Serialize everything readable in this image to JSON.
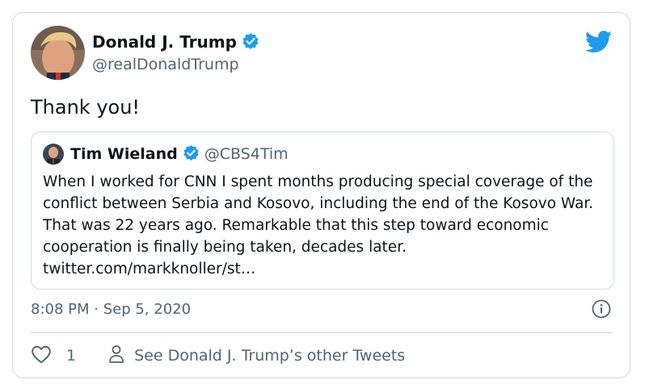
{
  "author": {
    "name": "Donald J. Trump",
    "handle": "@realDonaldTrump"
  },
  "tweet": {
    "text": "Thank you!",
    "timestamp": "8:08 PM · Sep 5, 2020"
  },
  "quoted": {
    "name": "Tim Wieland",
    "handle": "@CBS4Tim",
    "text": "When I worked for CNN I spent months producing special coverage of the conflict between Serbia and Kosovo, including the end of the Kosovo War. That was 22 years ago. Remarkable that this step toward economic cooperation is finally being taken, decades later. twitter.com/markknoller/st…"
  },
  "footer": {
    "like_count": "1",
    "profile_link": "See Donald J. Trump’s other Tweets"
  },
  "icons": {
    "twitter": "twitter-bird-icon",
    "verified": "verified-badge-icon",
    "info": "info-icon",
    "like": "heart-icon",
    "profile": "person-icon"
  },
  "colors": {
    "brand": "#1d9bf0",
    "text": "#0f1419",
    "secondary": "#536471",
    "border": "#cfd9de"
  }
}
